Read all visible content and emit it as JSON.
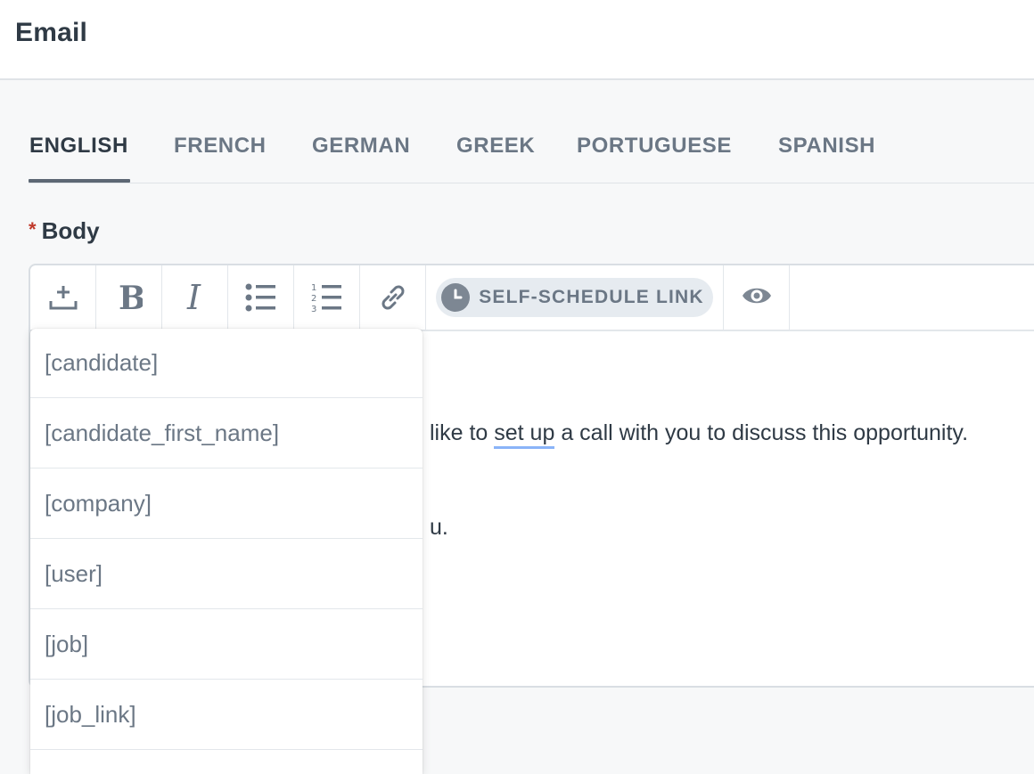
{
  "header": {
    "title": "Email"
  },
  "tabs": [
    {
      "label": "ENGLISH",
      "active": true
    },
    {
      "label": "FRENCH",
      "active": false
    },
    {
      "label": "GERMAN",
      "active": false
    },
    {
      "label": "GREEK",
      "active": false
    },
    {
      "label": "PORTUGUESE",
      "active": false
    },
    {
      "label": "SPANISH",
      "active": false
    }
  ],
  "body_field": {
    "required_mark": "*",
    "label": "Body"
  },
  "toolbar": {
    "buttons": [
      {
        "icon": "insert-placeholder-icon"
      },
      {
        "icon": "bold-icon"
      },
      {
        "icon": "italic-icon"
      },
      {
        "icon": "bulleted-list-icon"
      },
      {
        "icon": "numbered-list-icon"
      },
      {
        "icon": "link-icon"
      }
    ],
    "self_schedule_label": "SELF-SCHEDULE LINK",
    "preview_icon": "eye-icon"
  },
  "editor": {
    "line1_before": "like to ",
    "line1_flagged": "set up",
    "line1_after": " a call with you to discuss this opportunity.",
    "line2": "u."
  },
  "placeholder_menu": {
    "items": [
      "[candidate]",
      "[candidate_first_name]",
      "[company]",
      "[user]",
      "[job]",
      "[job_link]"
    ]
  },
  "colors": {
    "text": "#2f3a45",
    "muted": "#6b7785",
    "required": "#c0392b",
    "spellcheck": "#8ab4f8"
  }
}
